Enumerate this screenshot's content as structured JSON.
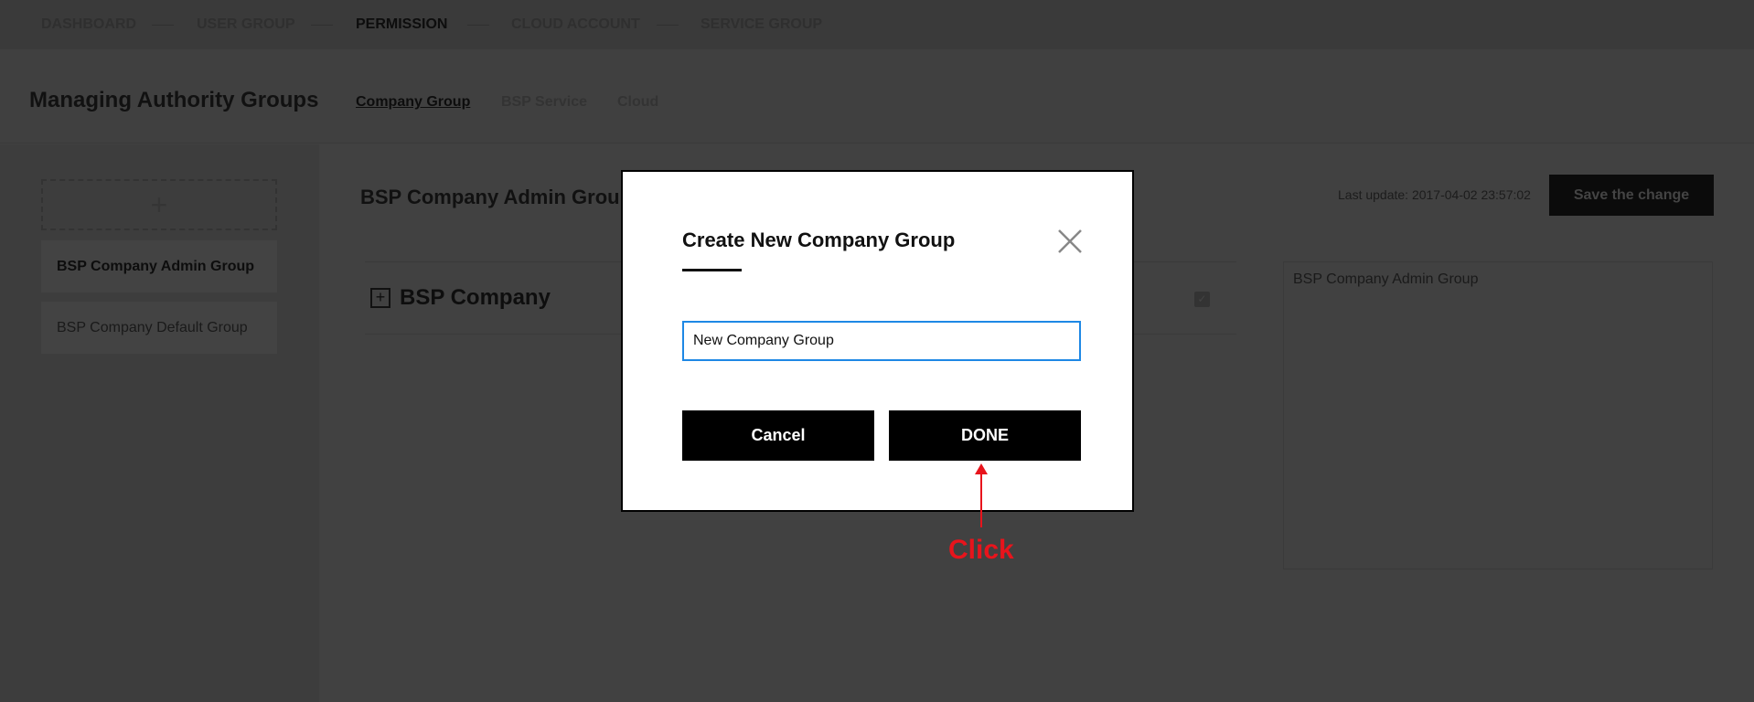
{
  "nav": {
    "items": [
      "DASHBOARD",
      "USER GROUP",
      "PERMISSION",
      "CLOUD ACCOUNT",
      "SERVICE GROUP"
    ],
    "active": "PERMISSION"
  },
  "header": {
    "title": "Managing Authority Groups",
    "tabs": [
      "Company Group",
      "BSP Service",
      "Cloud"
    ],
    "active_tab": "Company Group"
  },
  "sidebar": {
    "add_icon": "plus-icon",
    "items": [
      "BSP Company Admin Group",
      "BSP Company Default Group"
    ]
  },
  "main": {
    "title": "BSP Company Admin Group",
    "last_update": "Last update: 2017-04-02 23:57:02",
    "save_label": "Save the change",
    "tree_item": "BSP Company",
    "panel_text": "BSP Company Admin Group"
  },
  "modal": {
    "title": "Create New Company Group",
    "input_value": "New Company Group",
    "cancel_label": "Cancel",
    "done_label": "DONE"
  },
  "annotation": {
    "label": "Click",
    "color": "#e8141c"
  }
}
